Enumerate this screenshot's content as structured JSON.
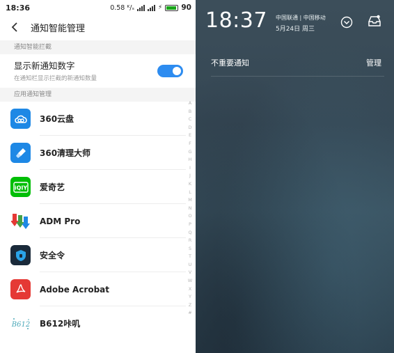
{
  "left": {
    "status": {
      "time": "18:36",
      "speed": "0.58 ᴷ/ₛ",
      "battery": "90"
    },
    "header": {
      "title": "通知智能管理"
    },
    "section1": {
      "title": "通知智能拦截"
    },
    "setting": {
      "title": "显示新通知数字",
      "subtitle": "在通知栏显示拦截的新通知数量",
      "enabled": true
    },
    "section2": {
      "title": "应用通知管理"
    },
    "apps": [
      {
        "name": "360云盘",
        "icon": "cloud-icon",
        "color": "#1e88e5"
      },
      {
        "name": "360清理大师",
        "icon": "broom-icon",
        "color": "#1e88e5"
      },
      {
        "name": "爱奇艺",
        "icon": "iqiyi-logo-icon",
        "color": "#00be06"
      },
      {
        "name": "ADM Pro",
        "icon": "download-arrows-icon",
        "color": "#e53935"
      },
      {
        "name": "安全令",
        "icon": "shield-icon",
        "color": "#1a2a3a"
      },
      {
        "name": "Adobe Acrobat",
        "icon": "acrobat-icon",
        "color": "#e53935"
      },
      {
        "name": "B612咔叽",
        "icon": "b612-logo-icon",
        "color": "#4aa8b8"
      }
    ],
    "alphabet": [
      "A",
      "B",
      "C",
      "D",
      "E",
      "F",
      "G",
      "H",
      "I",
      "J",
      "K",
      "L",
      "M",
      "N",
      "O",
      "P",
      "Q",
      "R",
      "S",
      "T",
      "U",
      "V",
      "W",
      "X",
      "Y",
      "Z",
      "#"
    ]
  },
  "right": {
    "time": "18:37",
    "carrier": "中国联通 | 中国移动",
    "date": "5月24日 周三",
    "notif_label": "不重要通知",
    "manage": "管理"
  },
  "colors": {
    "accent": "#2d8cf0"
  }
}
